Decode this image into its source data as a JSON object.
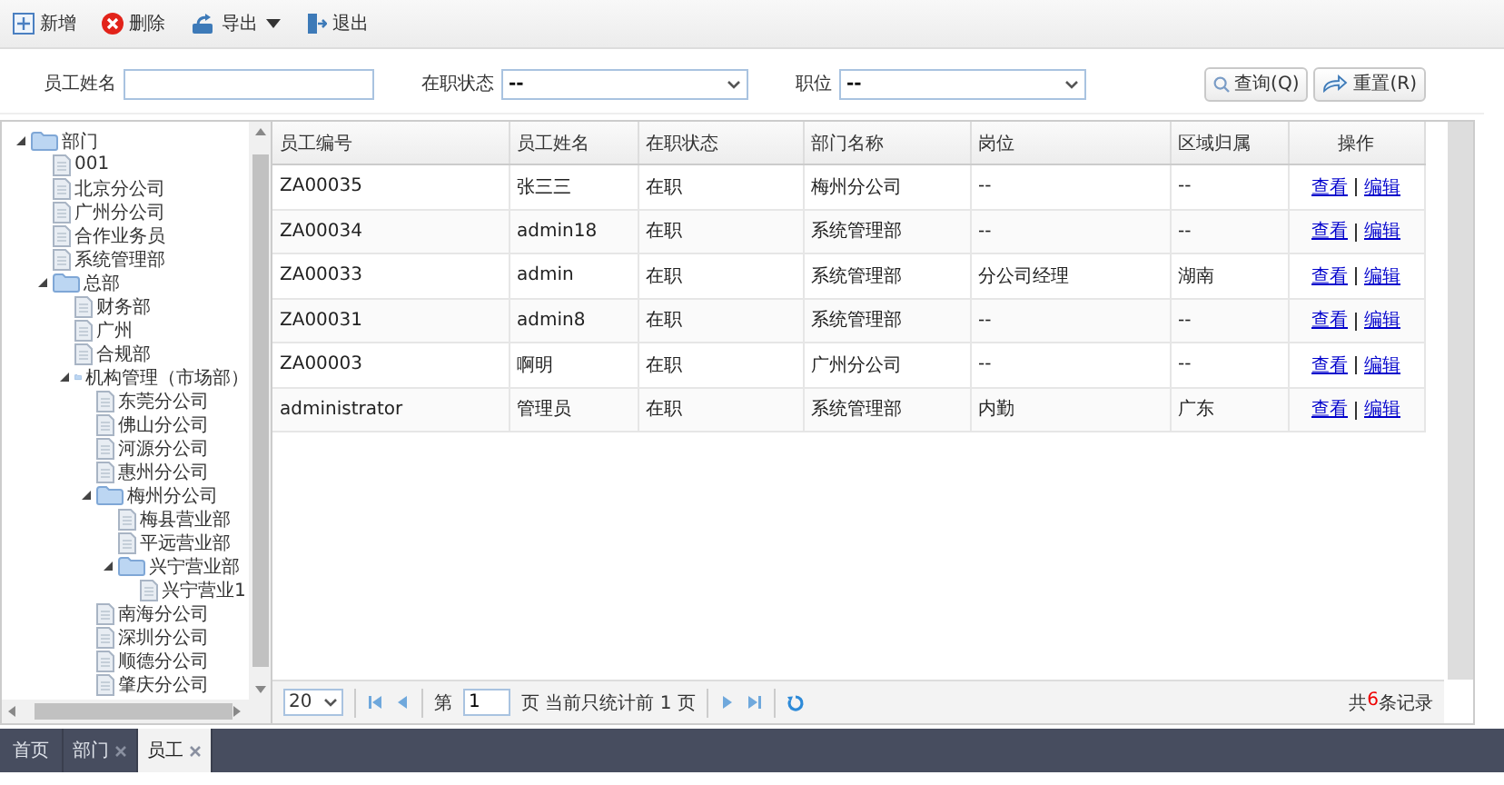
{
  "toolbar": [
    {
      "kind": "add",
      "label": "新增"
    },
    {
      "kind": "delete",
      "label": "删除"
    },
    {
      "kind": "export",
      "label": "导出",
      "dropdown": true
    },
    {
      "kind": "exit",
      "label": "退出"
    }
  ],
  "filters": [
    {
      "kind": "text",
      "label": "员工姓名"
    },
    {
      "kind": "select",
      "label": "在职状态",
      "value": "--"
    },
    {
      "kind": "select",
      "label": "职位",
      "value": "--"
    }
  ],
  "search_buttons": [
    {
      "kind": "search",
      "label": "查询(Q)"
    },
    {
      "kind": "reset",
      "label": "重置(R)"
    }
  ],
  "tree": [
    {
      "label": "部门",
      "expanded": true,
      "children": [
        {
          "label": "001"
        },
        {
          "label": "北京分公司"
        },
        {
          "label": "广州分公司"
        },
        {
          "label": "合作业务员"
        },
        {
          "label": "系统管理部"
        },
        {
          "label": "总部",
          "expanded": true,
          "children": [
            {
              "label": "财务部"
            },
            {
              "label": "广州"
            },
            {
              "label": "合规部"
            },
            {
              "label": "机构管理（市场部）",
              "expanded": true,
              "children": [
                {
                  "label": "东莞分公司"
                },
                {
                  "label": "佛山分公司"
                },
                {
                  "label": "河源分公司"
                },
                {
                  "label": "惠州分公司"
                },
                {
                  "label": "梅州分公司",
                  "expanded": true,
                  "children": [
                    {
                      "label": "梅县营业部"
                    },
                    {
                      "label": "平远营业部"
                    },
                    {
                      "label": "兴宁营业部",
                      "expanded": true,
                      "children": [
                        {
                          "label": "兴宁营业1"
                        }
                      ]
                    }
                  ]
                },
                {
                  "label": "南海分公司"
                },
                {
                  "label": "深圳分公司"
                },
                {
                  "label": "顺德分公司"
                },
                {
                  "label": "肇庆分公司"
                }
              ]
            }
          ]
        }
      ]
    }
  ],
  "table": {
    "columns": [
      "员工编号",
      "员工姓名",
      "在职状态",
      "部门名称",
      "岗位",
      "区域归属",
      "操作"
    ],
    "rows": [
      {
        "cells": [
          "ZA00035",
          "张三三",
          "在职",
          "梅州分公司",
          "--",
          "--"
        ],
        "actions": [
          "查看",
          "编辑"
        ]
      },
      {
        "cells": [
          "ZA00034",
          "admin18",
          "在职",
          "系统管理部",
          "--",
          "--"
        ],
        "actions": [
          "查看",
          "编辑"
        ]
      },
      {
        "cells": [
          "ZA00033",
          "admin",
          "在职",
          "系统管理部",
          "分公司经理",
          "湖南"
        ],
        "actions": [
          "查看",
          "编辑"
        ]
      },
      {
        "cells": [
          "ZA00031",
          "admin8",
          "在职",
          "系统管理部",
          "--",
          "--"
        ],
        "actions": [
          "查看",
          "编辑"
        ]
      },
      {
        "cells": [
          "ZA00003",
          "啊明",
          "在职",
          "广州分公司",
          "--",
          "--"
        ],
        "actions": [
          "查看",
          "编辑"
        ]
      },
      {
        "cells": [
          "administrator",
          "管理员",
          "在职",
          "系统管理部",
          "内勤",
          "广东"
        ],
        "actions": [
          "查看",
          "编辑"
        ]
      }
    ]
  },
  "pager": {
    "page_size": "20",
    "page_prefix": "第",
    "page": "1",
    "page_info": "页 当前只统计前 1 页",
    "total_prefix": "共",
    "total": "6",
    "total_suffix": "条记录"
  },
  "tabs": [
    {
      "label": "首页",
      "closable": false,
      "selected": false
    },
    {
      "label": "部门",
      "closable": true,
      "selected": false
    },
    {
      "label": "员工",
      "closable": true,
      "selected": true
    }
  ]
}
